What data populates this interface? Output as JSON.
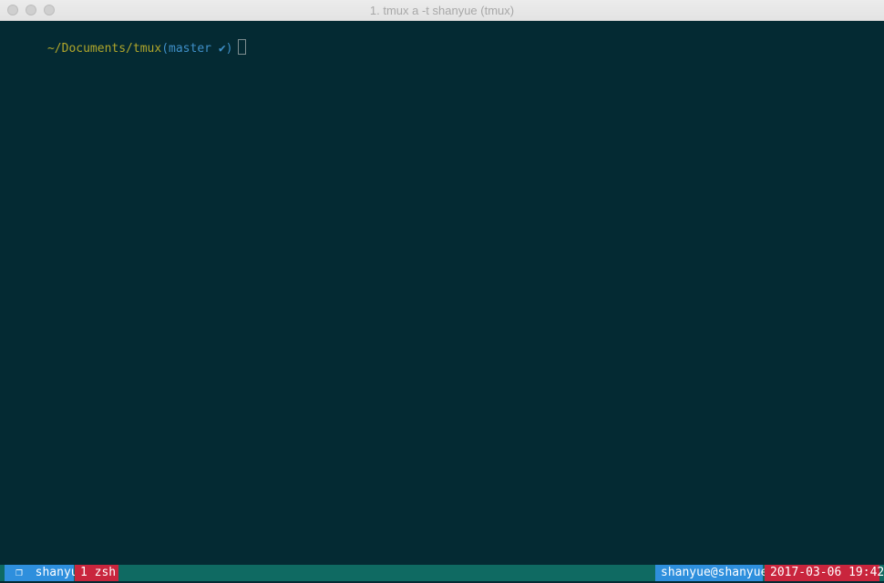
{
  "window": {
    "title": "1. tmux a -t shanyue (tmux)"
  },
  "terminal": {
    "prompt_path": "~/Documents/tmux",
    "prompt_open": "(",
    "prompt_branch": "master ✔",
    "prompt_close": ")"
  },
  "status": {
    "session_icon": "❐",
    "session": "shanyue",
    "window_tab": "1 zsh",
    "host": "shanyue@shanyue",
    "datetime": "2017-03-06 19:42"
  },
  "colors": {
    "terminal_bg": "#042a33",
    "status_bg": "#0f6a62",
    "blue_segment": "#2e8fdd",
    "red_segment": "#c9253d",
    "path_yellow": "#b0a62b",
    "branch_blue": "#3f8fc8"
  },
  "icons": {
    "close": "close-window-icon",
    "minimize": "minimize-window-icon",
    "maximize": "maximize-window-icon",
    "session": "session-icon"
  }
}
